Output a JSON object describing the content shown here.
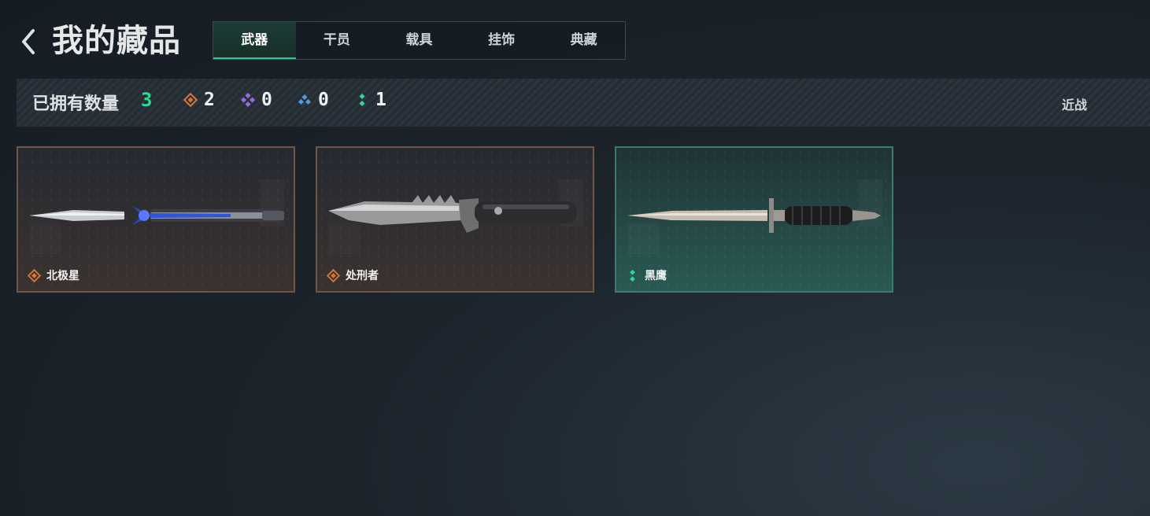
{
  "header": {
    "title": "我的藏品"
  },
  "tabs": [
    {
      "label": "武器",
      "active": true
    },
    {
      "label": "干员"
    },
    {
      "label": "载具"
    },
    {
      "label": "挂饰"
    },
    {
      "label": "典藏"
    }
  ],
  "stats": {
    "label": "已拥有数量",
    "total": "3",
    "rarities": [
      {
        "icon": "orange-rarity-icon",
        "color": "#d9773a",
        "count": "2"
      },
      {
        "icon": "purple-rarity-icon",
        "color": "#9b6ae0",
        "count": "0"
      },
      {
        "icon": "blue-rarity-icon",
        "color": "#4f9be0",
        "count": "0"
      },
      {
        "icon": "green-rarity-icon",
        "color": "#2fd896",
        "count": "1"
      }
    ],
    "category": "近战"
  },
  "items": [
    {
      "name": "北极星",
      "rarity": "orange"
    },
    {
      "name": "处刑者",
      "rarity": "orange"
    },
    {
      "name": "黑鹰",
      "rarity": "green"
    }
  ],
  "colors": {
    "accent": "#2fd896",
    "orange": "#d9773a",
    "green": "#2ec79a"
  }
}
